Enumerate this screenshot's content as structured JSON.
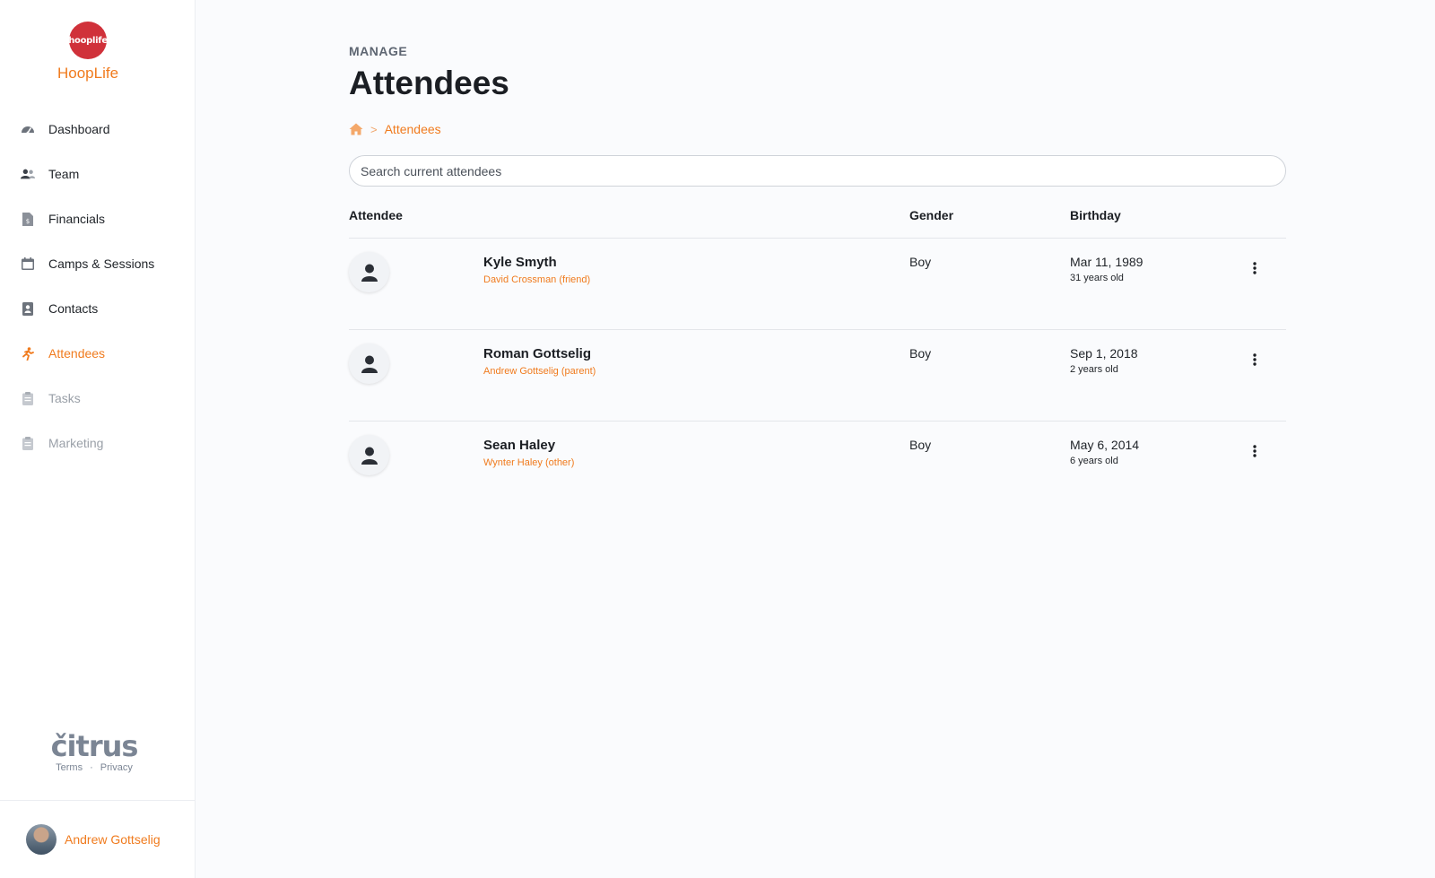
{
  "brand": {
    "logo_text": "hooplife",
    "name": "HoopLife"
  },
  "sidebar": {
    "items": [
      {
        "label": "Dashboard",
        "icon": "speedometer-icon"
      },
      {
        "label": "Team",
        "icon": "people-icon"
      },
      {
        "label": "Financials",
        "icon": "invoice-icon"
      },
      {
        "label": "Camps & Sessions",
        "icon": "calendar-icon"
      },
      {
        "label": "Contacts",
        "icon": "contact-card-icon"
      },
      {
        "label": "Attendees",
        "icon": "running-person-icon",
        "active": true
      },
      {
        "label": "Tasks",
        "icon": "clipboard-icon",
        "disabled": true
      },
      {
        "label": "Marketing",
        "icon": "clipboard-icon",
        "disabled": true
      }
    ]
  },
  "footer": {
    "logo_text": "čitrus",
    "terms": "Terms",
    "separator": "·",
    "privacy": "Privacy"
  },
  "user": {
    "name": "Andrew Gottselig"
  },
  "header": {
    "eyebrow": "MANAGE",
    "title": "Attendees"
  },
  "breadcrumb": {
    "separator": ">",
    "current": "Attendees"
  },
  "search": {
    "placeholder": "Search current attendees",
    "value": ""
  },
  "table": {
    "columns": {
      "attendee": "Attendee",
      "gender": "Gender",
      "birthday": "Birthday"
    },
    "rows": [
      {
        "name": "Kyle Smyth",
        "contact": "David Crossman (friend)",
        "gender": "Boy",
        "birthday": "Mar 11, 1989",
        "age": "31 years old"
      },
      {
        "name": "Roman Gottselig",
        "contact": "Andrew Gottselig (parent)",
        "gender": "Boy",
        "birthday": "Sep 1, 2018",
        "age": "2 years old"
      },
      {
        "name": "Sean Haley",
        "contact": "Wynter Haley (other)",
        "gender": "Boy",
        "birthday": "May 6, 2014",
        "age": "6 years old"
      }
    ]
  },
  "colors": {
    "accent": "#f07b1e",
    "brand_red": "#d0313a",
    "muted": "#9aa0a8"
  }
}
